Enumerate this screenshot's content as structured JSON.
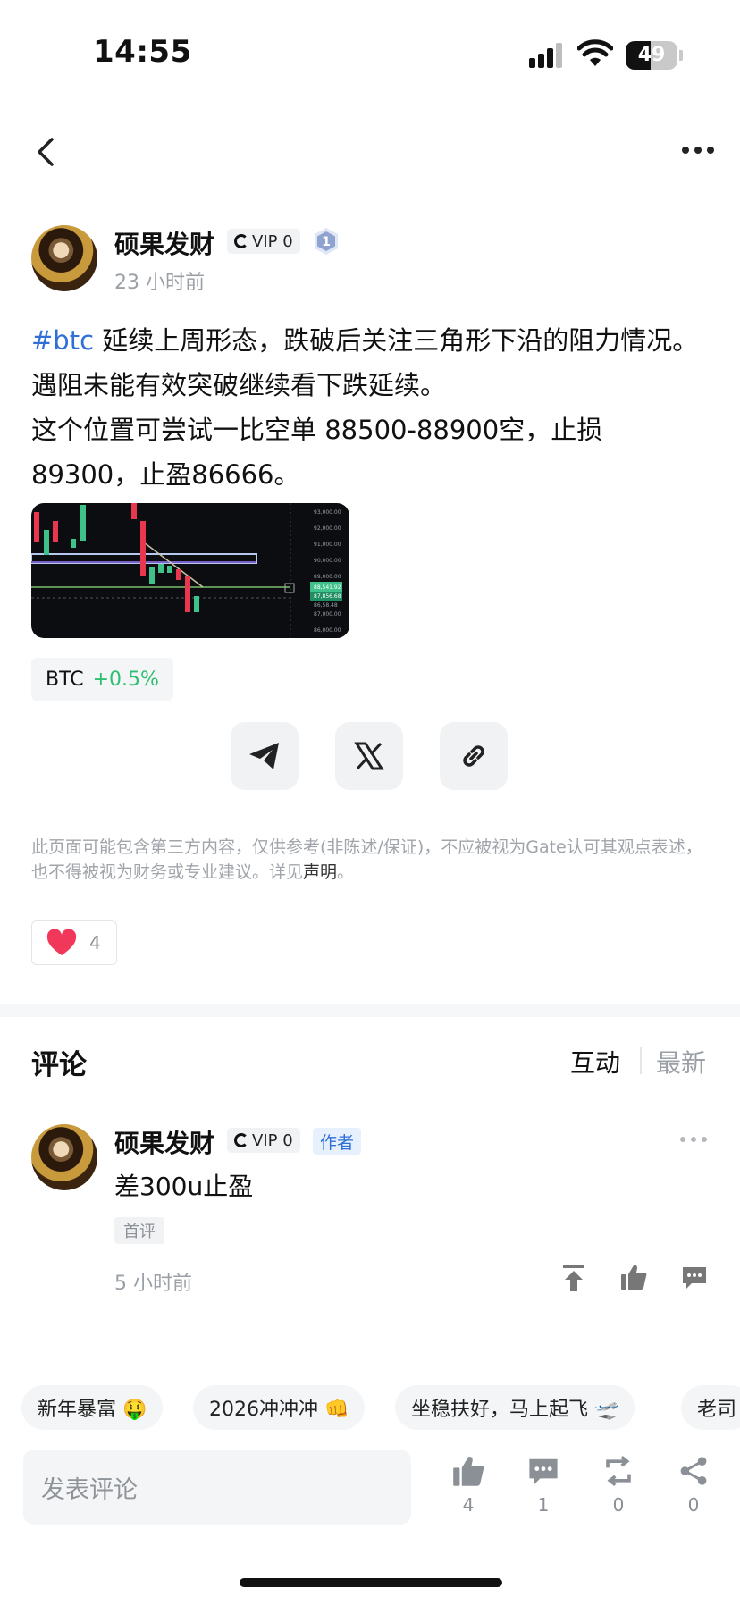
{
  "status_bar": {
    "time": "14:55",
    "battery": "49",
    "battery_level": 0.49
  },
  "post": {
    "author": "硕果发财",
    "vip": "VIP 0",
    "level": "1",
    "time": "23 小时前",
    "hashtag": "#btc",
    "text_line1": " 延续上周形态，跌破后关注三角形下沿的阻力情况。遇阻未能有效突破继续看下跌延续。",
    "text_line2": "这个位置可尝试一比空单 88500-88900空，止损89300，止盈86666。"
  },
  "chart_thumb": {
    "price_labels": [
      "93,000.00",
      "92,000.00",
      "91,000.00",
      "90,000.00",
      "89,000.00",
      "88,541.92",
      "87,856.68",
      "86,58.48",
      "87,000.00",
      "86,000.00"
    ]
  },
  "ticker": {
    "symbol": "BTC",
    "change": "+0.5%"
  },
  "share": {
    "icons": [
      "telegram-icon",
      "x-icon",
      "link-icon"
    ]
  },
  "disclaimer": {
    "text": "此页面可能包含第三方内容，仅供参考(非陈述/保证)，不应被视为Gate认可其观点表述，也不得被视为财务或专业建议。详见",
    "link": "声明",
    "end": "。"
  },
  "likes": {
    "count": "4"
  },
  "comments": {
    "title": "评论",
    "sort_active": "互动",
    "sort_other": "最新",
    "items": [
      {
        "author": "硕果发财",
        "vip": "VIP 0",
        "tag": "作者",
        "text": "差300u止盈",
        "badge": "首评",
        "time": "5 小时前"
      }
    ]
  },
  "quick_replies": [
    "新年暴富 🤑",
    "2026冲冲冲 👊",
    "坐稳扶好，马上起飞 🛫",
    "老司"
  ],
  "bottom_bar": {
    "placeholder": "发表评论",
    "like_count": "4",
    "comment_count": "1",
    "repost_count": "0",
    "share_count": "0"
  },
  "colors": {
    "accent_blue": "#2f6fd6",
    "up_green": "#2fbf71",
    "like_red": "#f2385a"
  }
}
